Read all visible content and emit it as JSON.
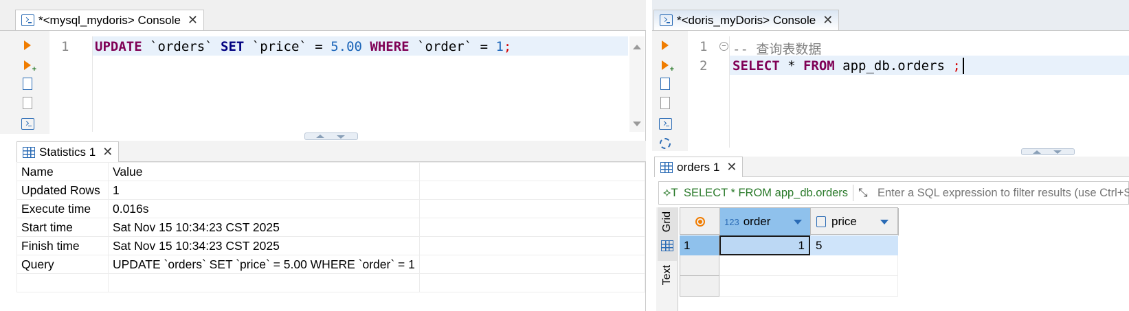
{
  "left": {
    "tab_title": "*<mysql_mydoris> Console",
    "editor": {
      "line_number": "1",
      "sql_tokens": [
        {
          "t": "UPDATE",
          "c": "kw"
        },
        {
          "t": " `orders` ",
          "c": "txt"
        },
        {
          "t": "SET",
          "c": "kw2"
        },
        {
          "t": " `price` = ",
          "c": "txt"
        },
        {
          "t": "5.00",
          "c": "num"
        },
        {
          "t": " ",
          "c": "txt"
        },
        {
          "t": "WHERE",
          "c": "kw"
        },
        {
          "t": " `order` = ",
          "c": "txt"
        },
        {
          "t": "1",
          "c": "num"
        },
        {
          "t": ";",
          "c": "punct"
        }
      ]
    },
    "results_tab": "Statistics 1",
    "stats": {
      "headers": [
        "Name",
        "Value"
      ],
      "rows": [
        [
          "Updated Rows",
          "1"
        ],
        [
          "Execute time",
          "0.016s"
        ],
        [
          "Start time",
          "Sat Nov 15 10:34:23 CST 2025"
        ],
        [
          "Finish time",
          "Sat Nov 15 10:34:23 CST 2025"
        ],
        [
          "Query",
          "UPDATE `orders` SET `price` = 5.00 WHERE `order` = 1"
        ]
      ]
    }
  },
  "right": {
    "tab_title": "*<doris_myDoris> Console",
    "editor": {
      "line_numbers": [
        "1",
        "2"
      ],
      "line1_comment": "-- 查询表数据",
      "line2_tokens": [
        {
          "t": "SELECT",
          "c": "kw"
        },
        {
          "t": " * ",
          "c": "txt"
        },
        {
          "t": "FROM",
          "c": "kw"
        },
        {
          "t": " app_db.orders ",
          "c": "txt"
        },
        {
          "t": ";",
          "c": "punct"
        }
      ]
    },
    "results_tab": "orders 1",
    "filter": {
      "query_text": "SELECT * FROM app_db.orders",
      "placeholder": "Enter a SQL expression to filter results (use Ctrl+Space)"
    },
    "grid": {
      "vtab_grid": "Grid",
      "vtab_text": "Text",
      "columns": [
        {
          "type_badge": "123",
          "name": "order"
        },
        {
          "type_badge": "",
          "name": "price"
        }
      ],
      "rows": [
        {
          "num": "1",
          "order": "1",
          "price": "5"
        }
      ]
    }
  },
  "colors": {
    "keyword": "#7f0055",
    "keyword_set": "#000080",
    "number": "#1a64b8",
    "punct": "#d40000",
    "selected_header": "#8fc1ec",
    "current_line": "#e8f1fb"
  }
}
